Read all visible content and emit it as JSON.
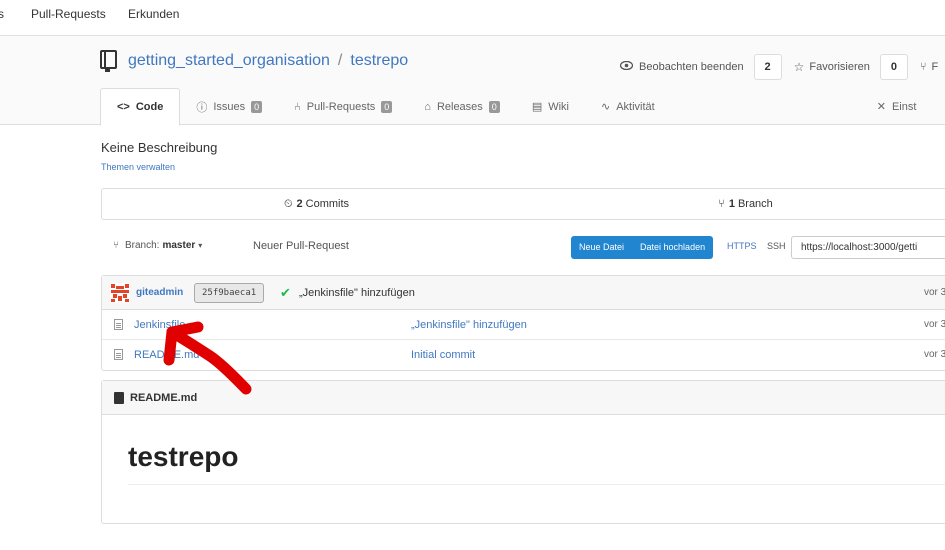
{
  "topnav": {
    "partial": "s",
    "pulls": "Pull-Requests",
    "explore": "Erkunden"
  },
  "repo": {
    "owner": "getting_started_organisation",
    "separator": "/",
    "name": "testrepo"
  },
  "watch": {
    "label": "Beobachten beenden",
    "count": "2"
  },
  "star": {
    "label": "Favorisieren",
    "count": "0"
  },
  "fork": {
    "label": "F"
  },
  "tabs": [
    {
      "label": "Code",
      "icon": "code-icon"
    },
    {
      "label": "Issues",
      "badge": "0",
      "icon": "issue-icon"
    },
    {
      "label": "Pull-Requests",
      "badge": "0",
      "icon": "pull-request-icon"
    },
    {
      "label": "Releases",
      "badge": "0",
      "icon": "tag-icon"
    },
    {
      "label": "Wiki",
      "icon": "book-icon"
    },
    {
      "label": "Aktivität",
      "icon": "pulse-icon"
    },
    {
      "label": "Einst",
      "icon": "tools-icon"
    }
  ],
  "description": "Keine Beschreibung",
  "topics_link": "Themen verwalten",
  "stats": {
    "commits_count": "2",
    "commits_label": "Commits",
    "branch_count": "1",
    "branch_label": "Branch"
  },
  "branch": {
    "label": "Branch:",
    "value": "master"
  },
  "new_pr": "Neuer Pull-Request",
  "buttons": {
    "new_file": "Neue Datei",
    "upload": "Datei hochladen"
  },
  "clone": {
    "https": "HTTPS",
    "ssh": "SSH",
    "url": "https://localhost:3000/getti"
  },
  "latest_commit": {
    "author": "giteadmin",
    "sha": "25f9baeca1",
    "message": "„Jenkinsfile\" hinzufügen",
    "age": "vor 3"
  },
  "files": [
    {
      "name": "Jenkinsfile",
      "message": "„Jenkinsfile\" hinzufügen",
      "age": "vor 3"
    },
    {
      "name": "README.md",
      "message": "Initial commit",
      "age": "vor 3"
    }
  ],
  "readme": {
    "filename": "README.md",
    "heading": "testrepo"
  },
  "colors": {
    "accent": "#4078c0",
    "button": "#2185d0",
    "annotation_arrow": "#e00000"
  }
}
